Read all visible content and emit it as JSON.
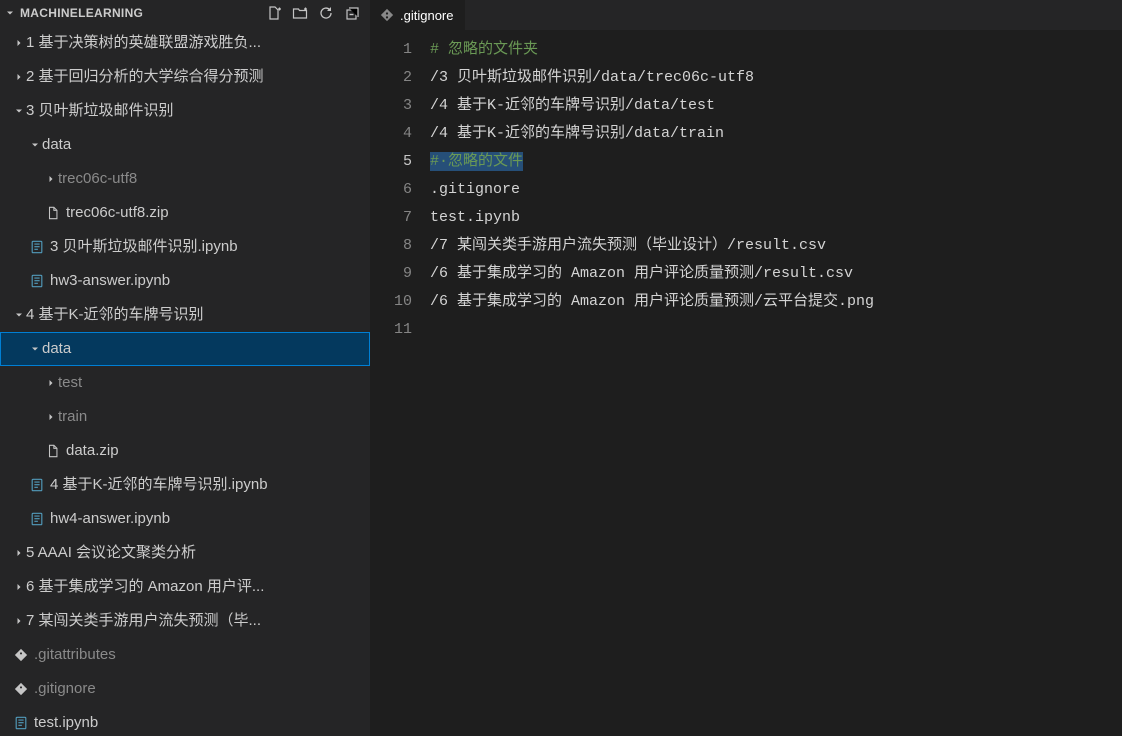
{
  "explorer": {
    "root_label": "MACHINELEARNING",
    "items": [
      {
        "kind": "folder",
        "state": "closed",
        "indent": 0,
        "label": "1 基于决策树的英雄联盟游戏胜负..."
      },
      {
        "kind": "folder",
        "state": "closed",
        "indent": 0,
        "label": "2 基于回归分析的大学综合得分预测"
      },
      {
        "kind": "folder",
        "state": "open",
        "indent": 0,
        "label": "3 贝叶斯垃圾邮件识别"
      },
      {
        "kind": "folder",
        "state": "open",
        "indent": 1,
        "label": "data"
      },
      {
        "kind": "folder",
        "state": "closed",
        "indent": 2,
        "label": "trec06c-utf8",
        "dim": true
      },
      {
        "kind": "file",
        "icon": "zip",
        "indent": 2,
        "label": "trec06c-utf8.zip"
      },
      {
        "kind": "file",
        "icon": "notebook",
        "indent": 1,
        "label": "3 贝叶斯垃圾邮件识别.ipynb"
      },
      {
        "kind": "file",
        "icon": "notebook",
        "indent": 1,
        "label": "hw3-answer.ipynb"
      },
      {
        "kind": "folder",
        "state": "open",
        "indent": 0,
        "label": "4 基于K-近邻的车牌号识别"
      },
      {
        "kind": "folder",
        "state": "open",
        "indent": 1,
        "label": "data",
        "selected": true
      },
      {
        "kind": "folder",
        "state": "closed",
        "indent": 2,
        "label": "test",
        "dim": true
      },
      {
        "kind": "folder",
        "state": "closed",
        "indent": 2,
        "label": "train",
        "dim": true
      },
      {
        "kind": "file",
        "icon": "zip",
        "indent": 2,
        "label": "data.zip"
      },
      {
        "kind": "file",
        "icon": "notebook",
        "indent": 1,
        "label": "4 基于K-近邻的车牌号识别.ipynb"
      },
      {
        "kind": "file",
        "icon": "notebook",
        "indent": 1,
        "label": "hw4-answer.ipynb"
      },
      {
        "kind": "folder",
        "state": "closed",
        "indent": 0,
        "label": "5 AAAI 会议论文聚类分析"
      },
      {
        "kind": "folder",
        "state": "closed",
        "indent": 0,
        "label": "6 基于集成学习的 Amazon 用户评..."
      },
      {
        "kind": "folder",
        "state": "closed",
        "indent": 0,
        "label": "7 某闯关类手游用户流失预测（毕..."
      },
      {
        "kind": "file",
        "icon": "git",
        "indent": 0,
        "label": ".gitattributes",
        "dim": true
      },
      {
        "kind": "file",
        "icon": "git",
        "indent": 0,
        "label": ".gitignore",
        "dim": true
      },
      {
        "kind": "file",
        "icon": "notebook",
        "indent": 0,
        "label": "test.ipynb"
      }
    ]
  },
  "editor": {
    "tab_label": ".gitignore",
    "current_line": 5,
    "lines": [
      {
        "type": "comment",
        "text": "# 忽略的文件夹"
      },
      {
        "type": "path",
        "text": "/3 贝叶斯垃圾邮件识别/data/trec06c-utf8"
      },
      {
        "type": "path",
        "text": "/4 基于K-近邻的车牌号识别/data/test"
      },
      {
        "type": "path",
        "text": "/4 基于K-近邻的车牌号识别/data/train"
      },
      {
        "type": "comment-sel",
        "text": "#·忽略的文件"
      },
      {
        "type": "path",
        "text": ".gitignore"
      },
      {
        "type": "path",
        "text": "test.ipynb"
      },
      {
        "type": "path",
        "text": "/7 某闯关类手游用户流失预测（毕业设计）/result.csv"
      },
      {
        "type": "path",
        "text": "/6 基于集成学习的 Amazon 用户评论质量预测/result.csv"
      },
      {
        "type": "path",
        "text": "/6 基于集成学习的 Amazon 用户评论质量预测/云平台提交.png"
      },
      {
        "type": "empty",
        "text": ""
      }
    ]
  }
}
